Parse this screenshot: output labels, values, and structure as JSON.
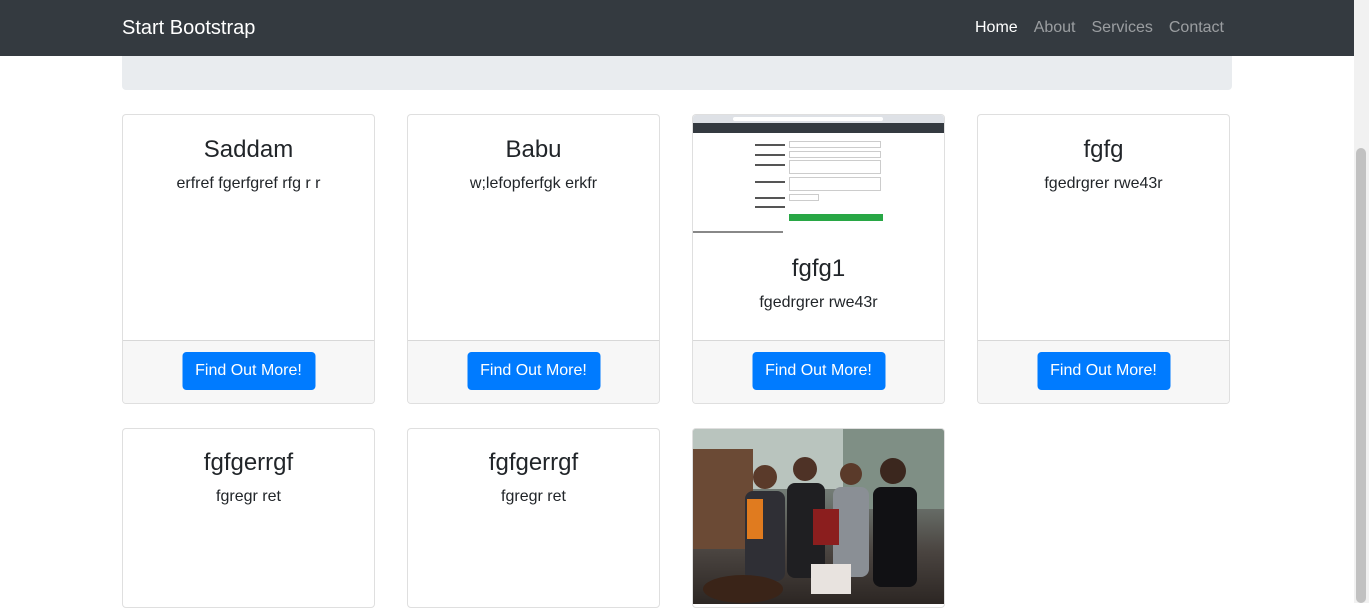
{
  "navbar": {
    "brand": "Start Bootstrap",
    "links": [
      {
        "label": "Home",
        "active": true
      },
      {
        "label": "About",
        "active": false
      },
      {
        "label": "Services",
        "active": false
      },
      {
        "label": "Contact",
        "active": false
      }
    ]
  },
  "cards": [
    {
      "title": "Saddam",
      "text": "erfref fgerfgref rfg r r",
      "button": "Find Out More!"
    },
    {
      "title": "Babu",
      "text": "w;lefopferfgk erkfr",
      "button": "Find Out More!"
    },
    {
      "title": "fgfg1",
      "text": "fgedrgrer rwe43r",
      "button": "Find Out More!",
      "image": "blog-admin-form-screenshot"
    },
    {
      "title": "fgfg",
      "text": "fgedrgrer rwe43r",
      "button": "Find Out More!"
    },
    {
      "title": "fgfgerrgf",
      "text": "fgregr ret"
    },
    {
      "title": "fgfgerrgf",
      "text": "fgregr ret"
    },
    {
      "image": "group-photo"
    }
  ],
  "colors": {
    "navbar": "#343a40",
    "jumbotron": "#e9ecef",
    "primary": "#007bff",
    "footer": "#f7f7f7"
  }
}
